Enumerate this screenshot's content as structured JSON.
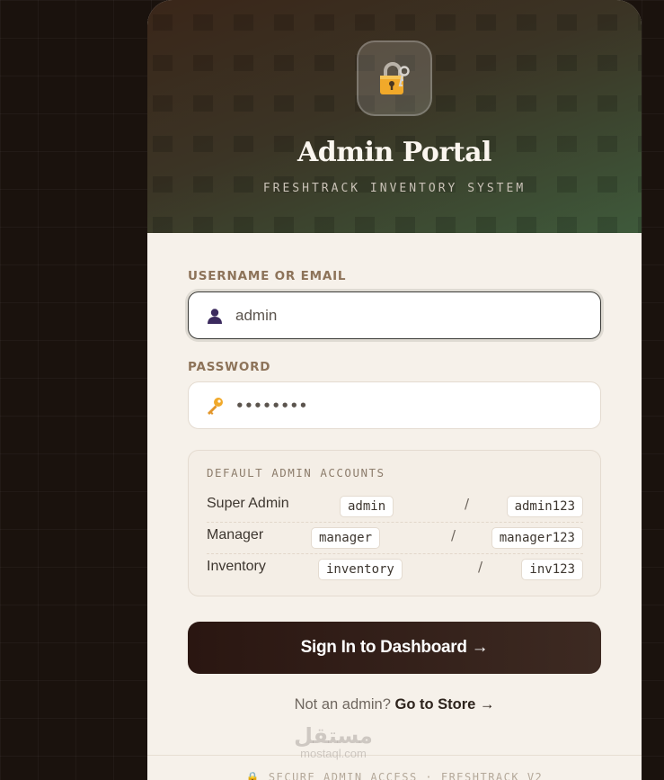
{
  "hero": {
    "title": "Admin Portal",
    "subtitle": "FRESHTRACK INVENTORY SYSTEM",
    "icon": "lock-with-key-icon"
  },
  "form": {
    "username_label": "USERNAME OR EMAIL",
    "username_value": "admin",
    "username_icon": "user-icon",
    "password_label": "PASSWORD",
    "password_value": "••••••••",
    "password_icon": "key-icon"
  },
  "accounts": {
    "title": "DEFAULT ADMIN ACCOUNTS",
    "separator": "/",
    "rows": [
      {
        "role": "Super Admin",
        "username": "admin",
        "password": "admin123"
      },
      {
        "role": "Manager",
        "username": "manager",
        "password": "manager123"
      },
      {
        "role": "Inventory",
        "username": "inventory",
        "password": "inv123"
      }
    ]
  },
  "actions": {
    "signin_label": "Sign In to Dashboard →",
    "store_prompt": "Not an admin?",
    "store_link": "Go to Store →"
  },
  "footer": {
    "text": "🔒 SECURE ADMIN ACCESS · FRESHTRACK V2"
  },
  "watermark": {
    "arabic": "مستقل",
    "latin": "mostaql.com"
  },
  "colors": {
    "page_bg": "#1a120d",
    "card_bg": "#f6f1ea",
    "label": "#8d7359",
    "button": "#2a1611",
    "hero_green": "#3e5a3b"
  }
}
